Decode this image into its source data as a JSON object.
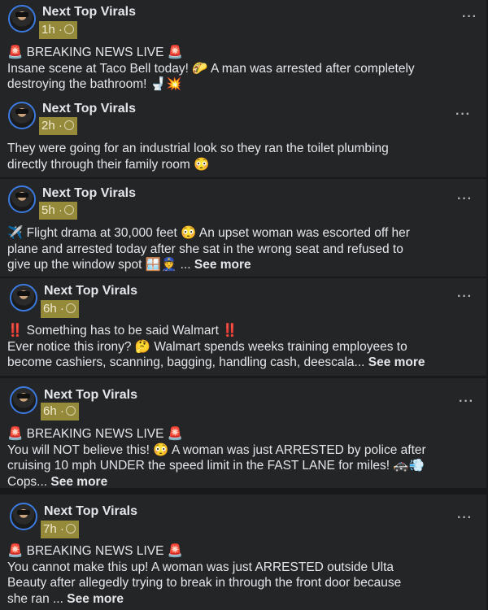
{
  "posts": [
    {
      "author": "Next Top Virals",
      "time": "1h ·",
      "more": "···",
      "lines": [
        "🚨 BREAKING NEWS LIVE 🚨",
        "Insane scene at Taco Bell today! 🌮 A man was arrested after completely",
        "destroying the bathroom! 🚽💥"
      ],
      "see_more": ""
    },
    {
      "author": "Next Top Virals",
      "time": "2h ·",
      "more": "···",
      "lines": [
        "They were going for an industrial look so they ran the toilet plumbing",
        "directly through their family room 😳"
      ],
      "see_more": ""
    },
    {
      "author": "Next Top Virals",
      "time": "5h ·",
      "more": "···",
      "lines": [
        "✈️ Flight drama at 30,000 feet 😳 An upset woman was escorted off her",
        "plane and arrested today after she sat in the wrong seat and refused to",
        "give up the window spot 🪟👮 ..."
      ],
      "see_more": "See more"
    },
    {
      "author": "Next Top Virals",
      "time": "6h ·",
      "more": "···",
      "lines": [
        "‼️ Something has to be said Walmart ‼️",
        "Ever notice this irony? 🤔 Walmart spends weeks training employees to",
        "become cashiers, scanning, bagging, handling cash, deescala..."
      ],
      "see_more": "See more"
    },
    {
      "author": "Next Top Virals",
      "time": "6h ·",
      "more": "···",
      "lines": [
        "🚨 BREAKING NEWS LIVE 🚨",
        "You will NOT believe this! 😳 A woman was just ARRESTED by police after",
        "cruising 10 mph UNDER the speed limit in the FAST LANE for miles! 🚓💨",
        "Cops..."
      ],
      "see_more": "See more"
    },
    {
      "author": "Next Top Virals",
      "time": "7h ·",
      "more": "···",
      "lines": [
        "🚨 BREAKING NEWS LIVE 🚨",
        "You cannot make this up! A woman was just ARRESTED outside Ulta",
        "Beauty after allegedly trying to break in through the front door because",
        "she ran ..."
      ],
      "see_more": "See more"
    }
  ]
}
